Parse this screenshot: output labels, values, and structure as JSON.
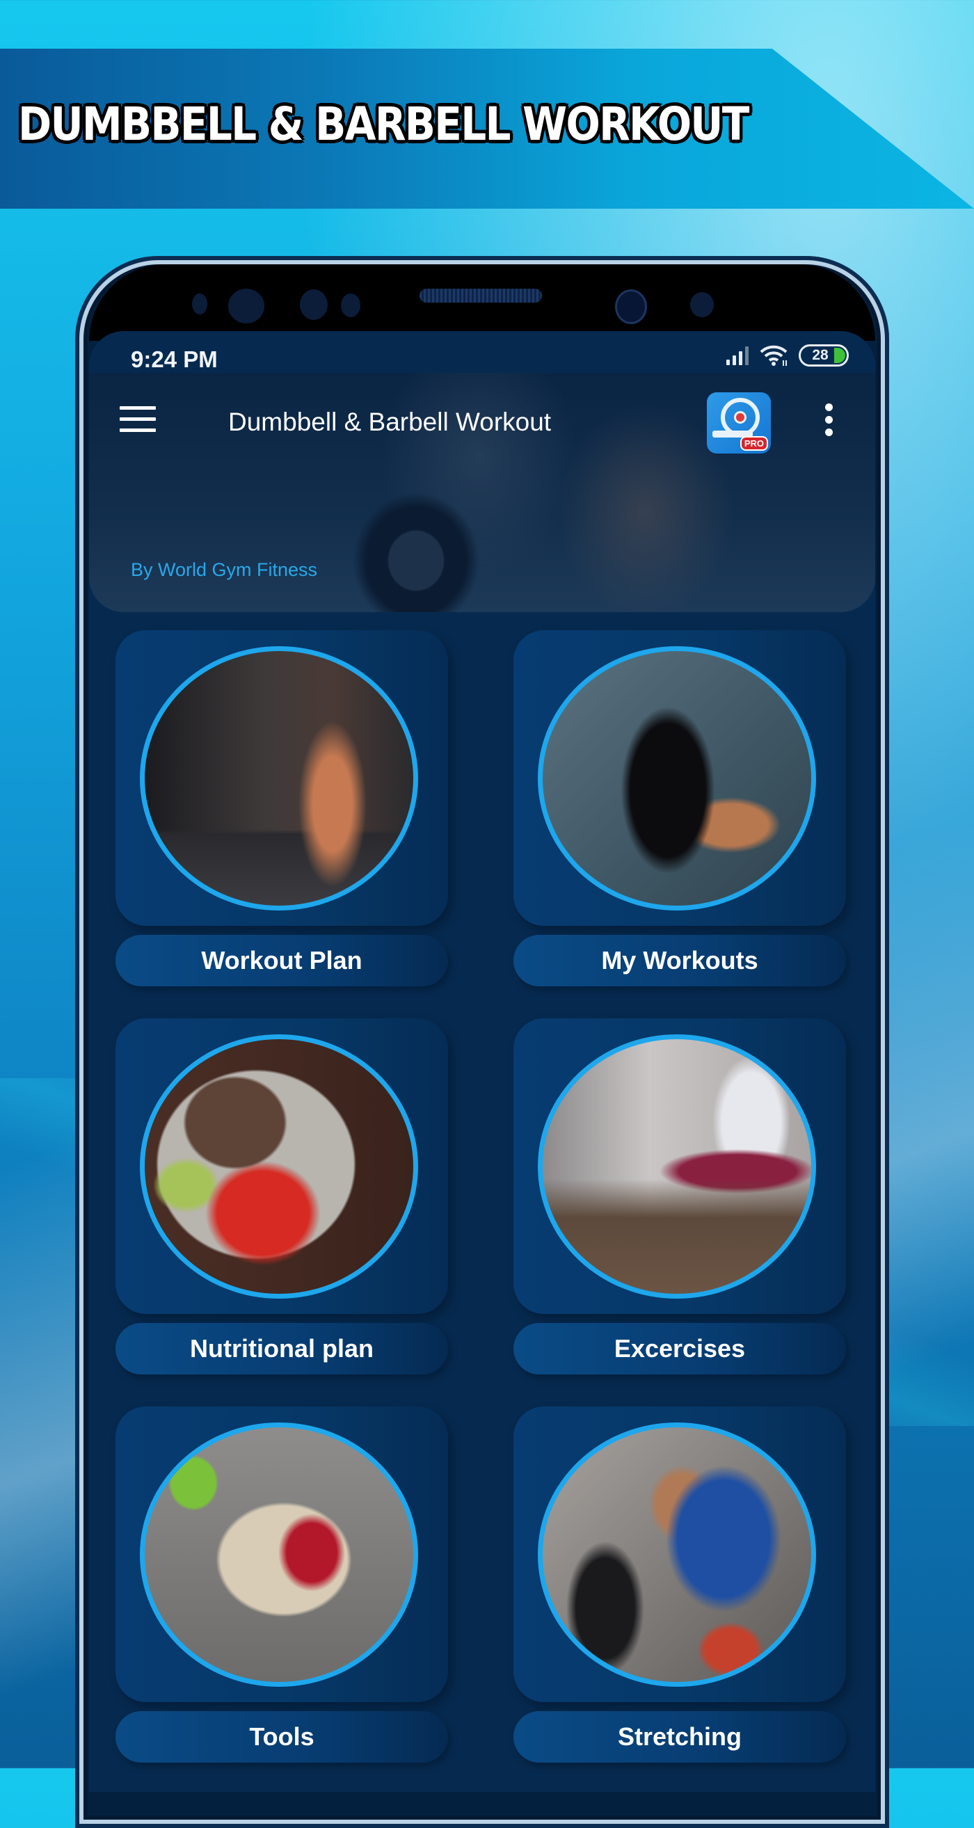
{
  "promo": {
    "headline": "DUMBBELL & BARBELL WORKOUT"
  },
  "status_bar": {
    "time": "9:24 PM",
    "battery_percent": "28",
    "icons": [
      "signal-icon",
      "wifi-icon",
      "battery-icon"
    ]
  },
  "app_bar": {
    "title": "Dumbbell & Barbell Workout",
    "subtitle": "By World Gym Fitness",
    "logo_badge": "PRO",
    "menu_icon": "hamburger-menu-icon",
    "overflow_icon": "more-vertical-icon"
  },
  "menu_tiles": [
    {
      "label": "Workout Plan",
      "image": "barbell-deadlift-photo"
    },
    {
      "label": "My Workouts",
      "image": "dumbbell-curl-photo"
    },
    {
      "label": "Nutritional plan",
      "image": "healthy-food-bowl-photo"
    },
    {
      "label": "Excercises",
      "image": "gym-barbell-photo"
    },
    {
      "label": "Tools",
      "image": "heart-food-stethoscope-photo"
    },
    {
      "label": "Stretching",
      "image": "man-stretching-photo"
    }
  ],
  "colors": {
    "accent_ring": "#1ea7ec",
    "subtitle_blue": "#2aa8e8",
    "screen_bg": "#062a4f",
    "battery_green": "#3fc23a"
  }
}
